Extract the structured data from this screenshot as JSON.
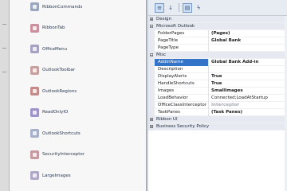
{
  "files": [
    {
      "label": "RibbonCommands",
      "color": "#9aa7bd"
    },
    {
      "label": "RibbonTab",
      "color": "#c98f9c"
    },
    {
      "label": "OfficeMenu",
      "color": "#a8a2c2"
    },
    {
      "label": "OutlookToolbar",
      "color": "#c8a19f"
    },
    {
      "label": "OutlookRegions",
      "color": "#c58b8b"
    },
    {
      "label": "ReadOnlyIO",
      "color": "#9e93c8"
    },
    {
      "label": "OutlookShortcuts",
      "color": "#a6b1c9"
    },
    {
      "label": "SecurityInterceptor",
      "color": "#c799a0"
    },
    {
      "label": "LargeImages",
      "color": "#b0a7c9"
    }
  ],
  "toolbar": {
    "categorized": "≡",
    "alphabetical": "↓",
    "properties": "▤",
    "events": "ϟ"
  },
  "props": [
    {
      "type": "cat",
      "name": "Design",
      "expander": "⊞"
    },
    {
      "type": "cat",
      "name": "Microsoft Outlook",
      "expander": "⊟"
    },
    {
      "type": "prop",
      "name": "FolderPages",
      "value": "(Pages)"
    },
    {
      "type": "prop",
      "name": "PageTitle",
      "value": "Global Bank"
    },
    {
      "type": "prop",
      "name": "PageType",
      "value": ""
    },
    {
      "type": "cat",
      "name": "Misc",
      "expander": "⊟"
    },
    {
      "type": "prop",
      "name": "AddinName",
      "value": "Global Bank Add-in",
      "selected": true
    },
    {
      "type": "prop",
      "name": "Description",
      "value": ""
    },
    {
      "type": "prop",
      "name": "DisplayAlerts",
      "value": "True"
    },
    {
      "type": "prop",
      "name": "HandleShortcuts",
      "value": "True"
    },
    {
      "type": "prop",
      "name": "Images",
      "value": "SmallImages"
    },
    {
      "type": "prop",
      "name": "LoadBehavior",
      "value": "Connected;LoadAtStartup",
      "plain": true
    },
    {
      "type": "prop",
      "name": "OfficeClassInterceptor",
      "value": "Interceptor",
      "muted": true
    },
    {
      "type": "prop",
      "name": "TaskPanes",
      "value": "(Task Panes)"
    },
    {
      "type": "cat",
      "name": "Ribbon UI",
      "expander": "⊞"
    },
    {
      "type": "cat",
      "name": "Business Security Policy",
      "expander": "⊞"
    }
  ]
}
